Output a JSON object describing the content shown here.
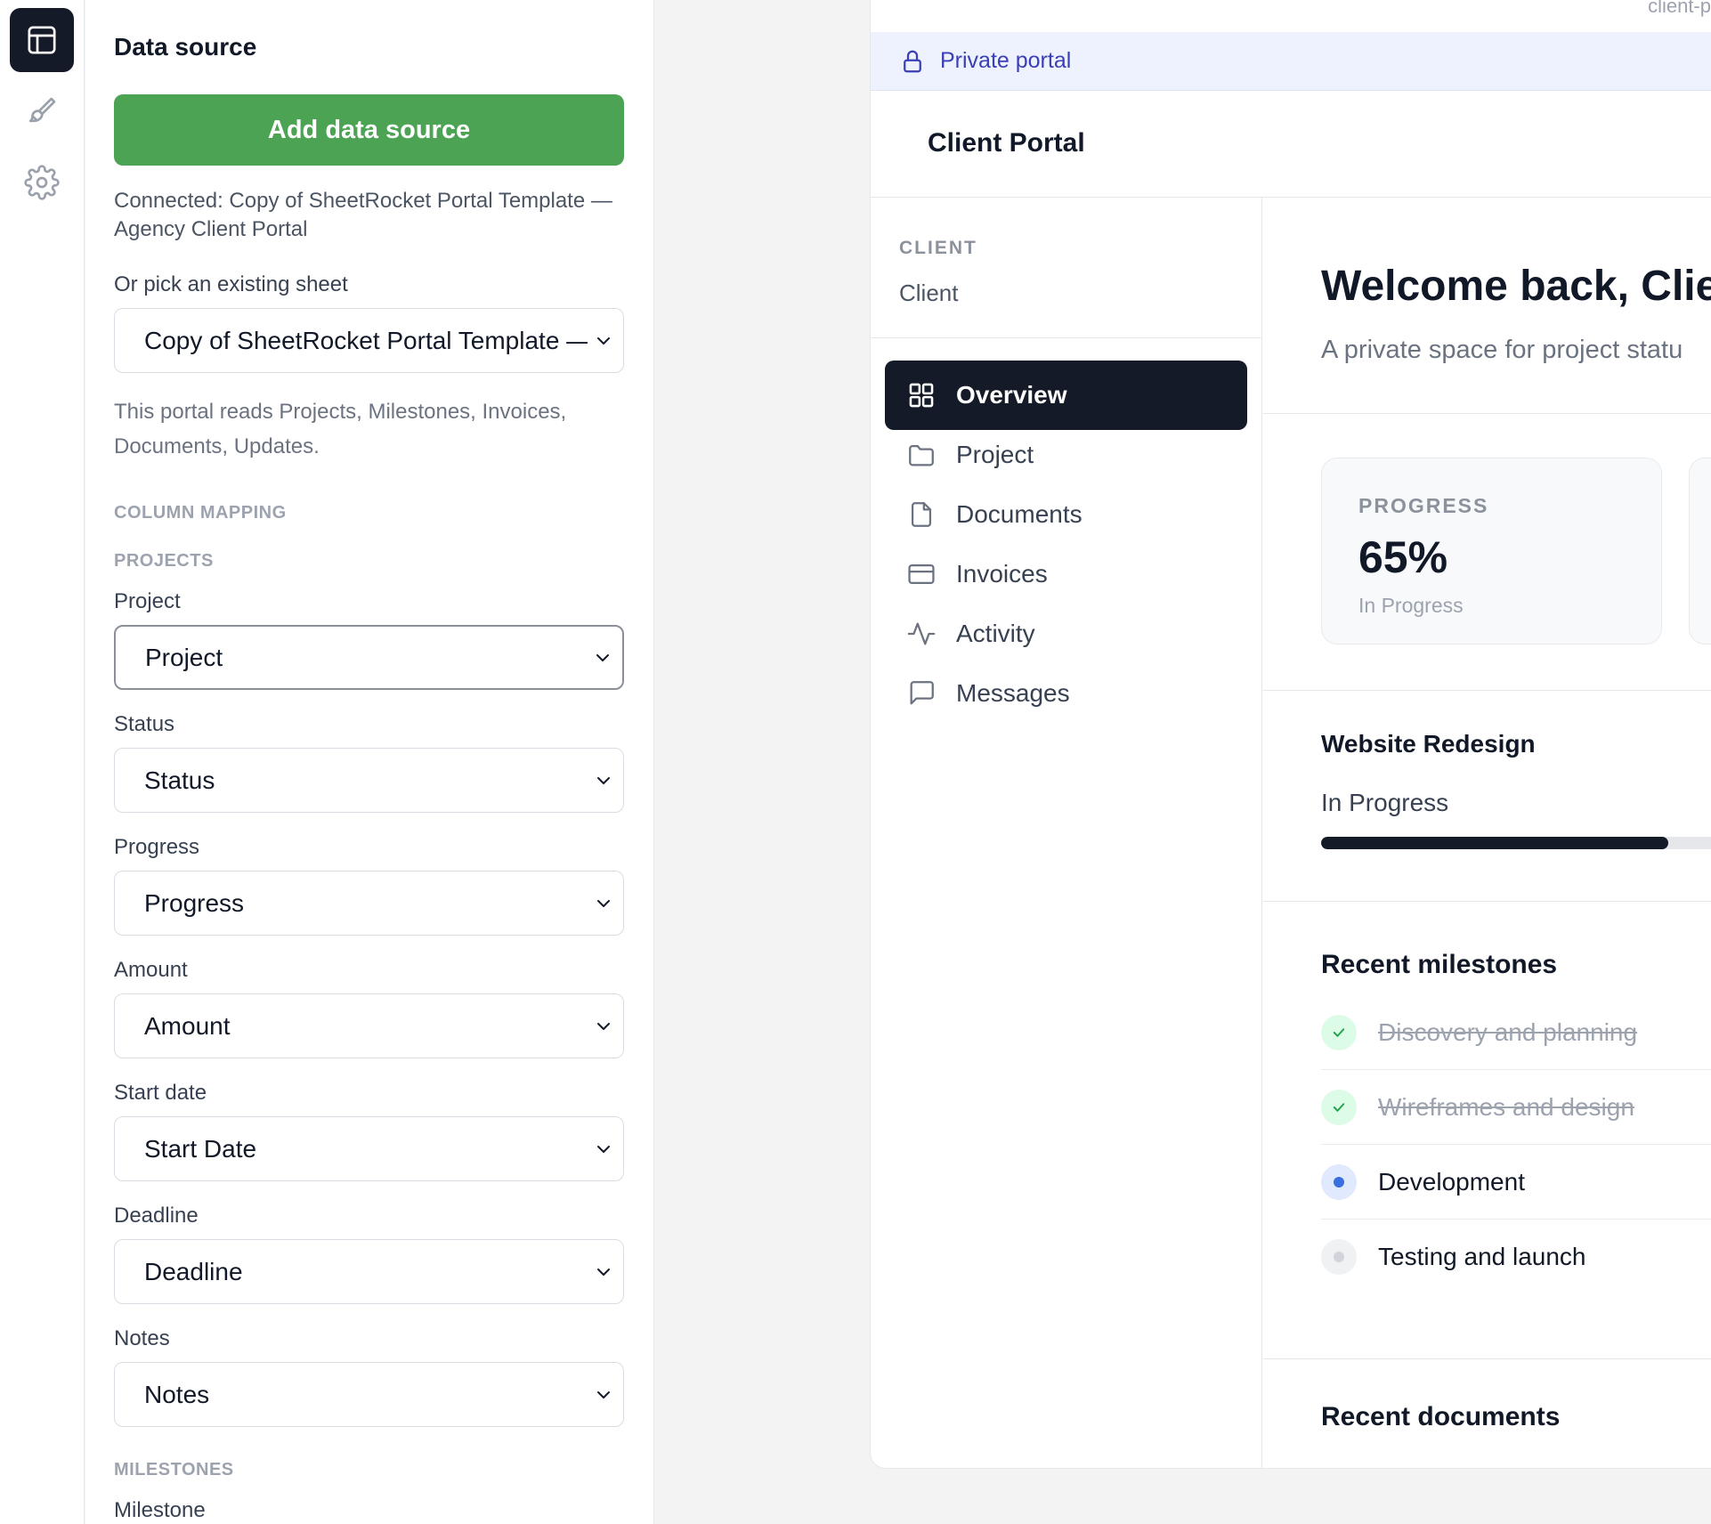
{
  "colors": {
    "accent_green": "#4ca354",
    "dark": "#151a28",
    "private_bar_bg": "#eef2fe",
    "private_bar_text": "#3a3fb5",
    "done_green": "#22a34a",
    "current_blue": "#3b6fe0"
  },
  "rail": {
    "items": [
      {
        "icon": "table-icon",
        "active": true
      },
      {
        "icon": "paintbrush-icon",
        "active": false
      },
      {
        "icon": "gear-icon",
        "active": false
      }
    ]
  },
  "panel": {
    "title": "Data source",
    "add_button": "Add data source",
    "connected_text": "Connected: Copy of SheetRocket Portal Template — Agency Client Portal",
    "pick_label": "Or pick an existing sheet",
    "sheet_select_value": "Copy of SheetRocket Portal Template — Agency Client Portal",
    "reads_hint": "This portal reads Projects, Milestones, Invoices, Documents, Updates.",
    "column_mapping_caption": "COLUMN MAPPING",
    "projects_caption": "PROJECTS",
    "fields": [
      {
        "label": "Project",
        "value": "Project"
      },
      {
        "label": "Status",
        "value": "Status"
      },
      {
        "label": "Progress",
        "value": "Progress"
      },
      {
        "label": "Amount",
        "value": "Amount"
      },
      {
        "label": "Start date",
        "value": "Start Date"
      },
      {
        "label": "Deadline",
        "value": "Deadline"
      },
      {
        "label": "Notes",
        "value": "Notes"
      }
    ],
    "milestones_caption": "MILESTONES",
    "milestone_label": "Milestone"
  },
  "preview": {
    "url_snippet": "client-p",
    "private_label": "Private portal",
    "portal_title": "Client Portal",
    "client_caption": "CLIENT",
    "client_name": "Client",
    "nav": [
      {
        "label": "Overview",
        "icon": "grid-icon",
        "active": true
      },
      {
        "label": "Project",
        "icon": "folder-icon",
        "active": false
      },
      {
        "label": "Documents",
        "icon": "document-icon",
        "active": false
      },
      {
        "label": "Invoices",
        "icon": "credit-card-icon",
        "active": false
      },
      {
        "label": "Activity",
        "icon": "activity-icon",
        "active": false
      },
      {
        "label": "Messages",
        "icon": "message-icon",
        "active": false
      }
    ],
    "welcome": "Welcome back, Clien",
    "welcome_sub": "A private space for project statu",
    "stat": {
      "caption": "PROGRESS",
      "value": "65%",
      "sub": "In Progress"
    },
    "project": {
      "name": "Website Redesign",
      "status": "In Progress",
      "progress": 0.65
    },
    "milestones_title": "Recent milestones",
    "milestones": [
      {
        "label": "Discovery and planning",
        "state": "done"
      },
      {
        "label": "Wireframes and design",
        "state": "done"
      },
      {
        "label": "Development",
        "state": "current"
      },
      {
        "label": "Testing and launch",
        "state": "todo"
      }
    ],
    "documents_title": "Recent documents"
  }
}
